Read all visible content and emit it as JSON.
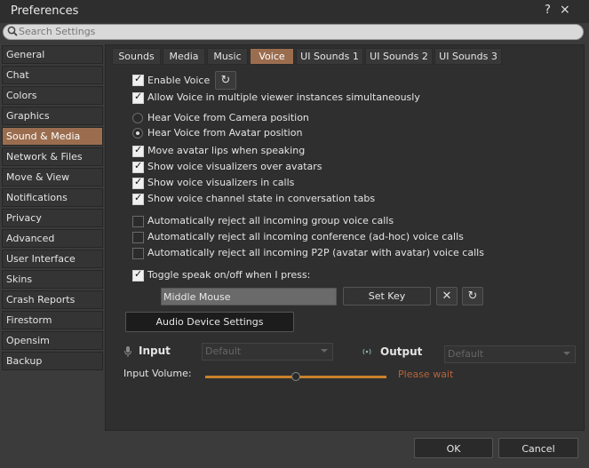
{
  "window": {
    "title": "Preferences",
    "help_icon": "?",
    "close_icon": "×"
  },
  "search": {
    "placeholder": "Search Settings",
    "value": ""
  },
  "sidebar": {
    "items": [
      {
        "label": "General"
      },
      {
        "label": "Chat"
      },
      {
        "label": "Colors"
      },
      {
        "label": "Graphics"
      },
      {
        "label": "Sound & Media",
        "selected": true
      },
      {
        "label": "Network & Files"
      },
      {
        "label": "Move & View"
      },
      {
        "label": "Notifications"
      },
      {
        "label": "Privacy"
      },
      {
        "label": "Advanced"
      },
      {
        "label": "User Interface"
      },
      {
        "label": "Skins"
      },
      {
        "label": "Crash Reports"
      },
      {
        "label": "Firestorm"
      },
      {
        "label": "Opensim"
      },
      {
        "label": "Backup"
      }
    ]
  },
  "tabs": [
    {
      "label": "Sounds"
    },
    {
      "label": "Media"
    },
    {
      "label": "Music"
    },
    {
      "label": "Voice",
      "selected": true
    },
    {
      "label": "UI Sounds 1"
    },
    {
      "label": "UI Sounds 2"
    },
    {
      "label": "UI Sounds 3"
    }
  ],
  "voice": {
    "enable_voice": {
      "label": "Enable Voice",
      "checked": true
    },
    "multi_instance": {
      "label": "Allow Voice in multiple viewer instances simultaneously",
      "checked": true
    },
    "hear_camera": {
      "label": "Hear Voice from Camera position",
      "selected": false
    },
    "hear_avatar": {
      "label": "Hear Voice from Avatar position",
      "selected": true
    },
    "lips": {
      "label": "Move avatar lips when speaking",
      "checked": true
    },
    "vis_avatars": {
      "label": "Show voice visualizers over avatars",
      "checked": true
    },
    "vis_calls": {
      "label": "Show voice visualizers in calls",
      "checked": true
    },
    "channel_state": {
      "label": "Show voice channel state in conversation tabs",
      "checked": true
    },
    "reject_group": {
      "label": "Automatically reject all incoming group voice calls",
      "checked": false
    },
    "reject_conf": {
      "label": "Automatically reject all incoming conference (ad-hoc) voice calls",
      "checked": false
    },
    "reject_p2p": {
      "label": "Automatically reject all incoming P2P (avatar with avatar) voice calls",
      "checked": false
    },
    "toggle_speak": {
      "label": "Toggle speak on/off when I press:",
      "checked": true
    },
    "key_value": "Middle Mouse",
    "set_key_label": "Set Key",
    "audio_device_label": "Audio Device Settings",
    "input_label": "Input",
    "input_device": "Default",
    "output_label": "Output",
    "output_device": "Default",
    "input_volume_label": "Input Volume:",
    "input_volume_level": 0.5,
    "please_wait": "Please wait"
  },
  "footer": {
    "ok_label": "OK",
    "cancel_label": "Cancel"
  },
  "colors": {
    "accent": "#9b6d4f",
    "slider": "#c8822a",
    "warn_text": "#b4643c"
  }
}
